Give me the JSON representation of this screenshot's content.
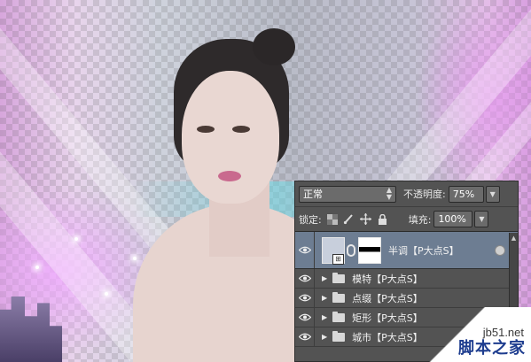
{
  "panel": {
    "blend_mode": "正常",
    "opacity_label": "不透明度:",
    "opacity_value": "75%",
    "lock_label": "锁定:",
    "fill_label": "填充:",
    "fill_value": "100%"
  },
  "layers": [
    {
      "name": "半调【P大点S】",
      "type": "adjustment",
      "visible": true,
      "selected": true
    },
    {
      "name": "模特【P大点S】",
      "type": "group",
      "visible": true,
      "selected": false
    },
    {
      "name": "点缀【P大点S】",
      "type": "group",
      "visible": true,
      "selected": false
    },
    {
      "name": "矩形【P大点S】",
      "type": "group",
      "visible": true,
      "selected": false
    },
    {
      "name": "城市【P大点S】",
      "type": "group",
      "visible": true,
      "selected": false
    }
  ],
  "watermark": {
    "url": "jb51.net",
    "text": "脚本之家"
  },
  "colors": {
    "panel_bg": "#535353",
    "selected_layer": "#6d7d92",
    "watermark_text": "#1e3d8f"
  }
}
